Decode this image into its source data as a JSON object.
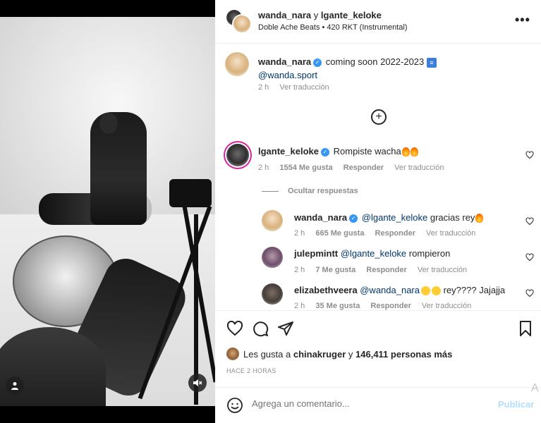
{
  "header": {
    "user1": "wanda_nara",
    "conjunction": "y",
    "user2": "lgante_keloke",
    "music": "Doble Ache Beats • 420 RKT (Instrumental)",
    "more_label": "•••"
  },
  "caption": {
    "username": "wanda_nara",
    "text": "coming soon 2022-2023",
    "mention": "@wanda.sport",
    "time": "2 h",
    "translate": "Ver traducción"
  },
  "comments": [
    {
      "username": "lgante_keloke",
      "text": "Rompiste wacha",
      "time": "2 h",
      "likes": "1554 Me gusta",
      "reply": "Responder",
      "translate": "Ver traducción"
    }
  ],
  "hide_replies": "Ocultar respuestas",
  "replies": [
    {
      "username": "wanda_nara",
      "mention": "@lgante_keloke",
      "text": "gracias rey",
      "time": "2 h",
      "likes": "665 Me gusta",
      "reply": "Responder",
      "translate": "Ver traducción"
    },
    {
      "username": "julepmintt",
      "mention": "@lgante_keloke",
      "text": "rompieron",
      "time": "2 h",
      "likes": "7 Me gusta",
      "reply": "Responder",
      "translate": "Ver traducción"
    },
    {
      "username": "elizabethveera",
      "mention": "@wanda_nara",
      "text": "rey???? Jajajja",
      "time": "2 h",
      "likes": "35 Me gusta",
      "reply": "Responder",
      "translate": "Ver traducción"
    }
  ],
  "likes": {
    "prefix": "Les gusta a",
    "user": "chinakruger",
    "middle": "y",
    "count": "146,411 personas más"
  },
  "time_ago": "HACE 2 HORAS",
  "composer": {
    "placeholder": "Agrega un comentario...",
    "publish": "Publicar",
    "watermark": "A"
  },
  "icons": {
    "heart": "heart-icon",
    "comment": "comment-icon",
    "share": "send-icon",
    "save": "bookmark-icon",
    "add": "plus-circle-icon",
    "emoji": "smile-icon",
    "tag": "user-tag-icon",
    "mute": "speaker-muted-icon"
  },
  "colors": {
    "verified": "#3897f0",
    "mention": "#00376b",
    "muted_text": "#8e8e8e",
    "publish_disabled": "#b2dffc"
  }
}
